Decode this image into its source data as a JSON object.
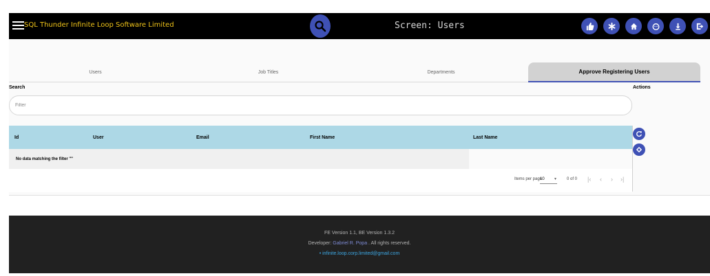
{
  "header": {
    "brand": "SQL Thunder Infinite Loop Software Limited",
    "screen_title": "Screen:  Users",
    "actions": [
      {
        "icon": "thumbs-up-icon"
      },
      {
        "icon": "asterisk-icon"
      },
      {
        "icon": "home-icon"
      },
      {
        "icon": "face-icon"
      },
      {
        "icon": "download-icon"
      },
      {
        "icon": "logout-icon"
      }
    ]
  },
  "tabs": [
    {
      "label": "Users",
      "active": false
    },
    {
      "label": "Job Titles",
      "active": false
    },
    {
      "label": "Departments",
      "active": false
    },
    {
      "label": "Approve Registering Users",
      "active": true
    }
  ],
  "search": {
    "label": "Search",
    "placeholder": "Filter"
  },
  "actions_label": "Actions",
  "table": {
    "columns": [
      "Id",
      "User",
      "Email",
      "First Name",
      "Last Name"
    ],
    "empty_message": "No data matching the filter \"\""
  },
  "paginator": {
    "items_per_page_label": "Items per page:",
    "page_size": "10",
    "range_label": "0 of 0"
  },
  "footer": {
    "version": "FE Version 1.1, BE Version 1.3.2",
    "developer_prefix": "Developer: ",
    "developer_name": "Gabriel R. Popa",
    "developer_suffix": " . All rights reserved.",
    "email": "infinite.loop.corp.limited@gmail.com"
  },
  "colors": {
    "topbar": "#000000",
    "brand_text": "#f0c419",
    "accent": "#3f51b5",
    "table_header": "#add8e6",
    "footer": "#212121"
  }
}
